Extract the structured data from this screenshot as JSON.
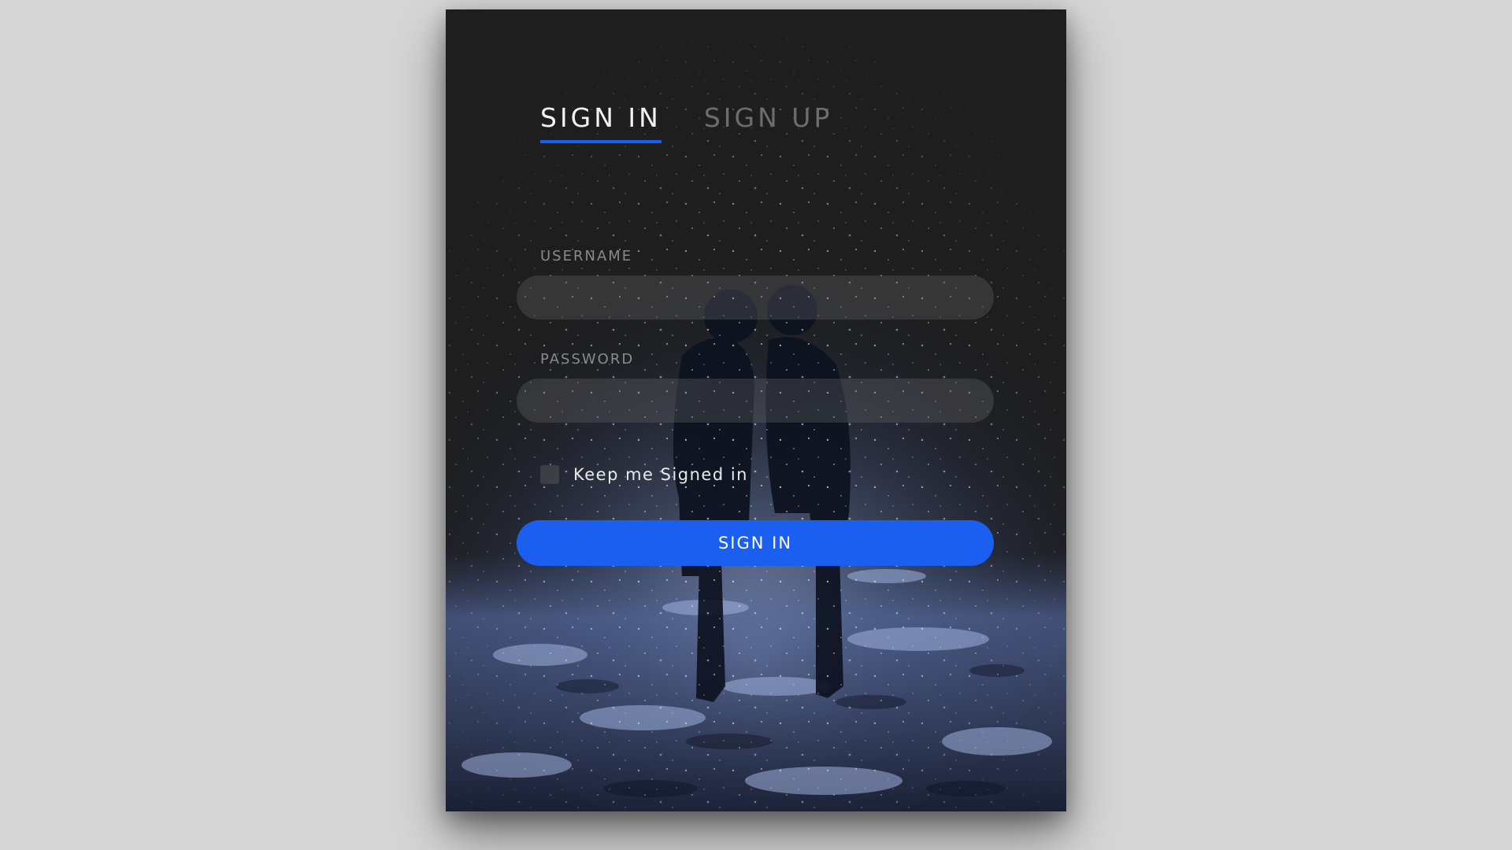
{
  "tabs": {
    "sign_in": "SIGN IN",
    "sign_up": "SIGN UP"
  },
  "form": {
    "username_label": "USERNAME",
    "username_value": "",
    "password_label": "PASSWORD",
    "password_value": "",
    "keep_signed_in_label": "Keep me Signed in",
    "keep_signed_in_checked": false,
    "submit_label": "SIGN IN"
  },
  "colors": {
    "accent": "#1a5ff0",
    "card_background": "#1e1e1f",
    "page_background": "#d6d6d6"
  },
  "background_image": "silhouette-couple-kissing-in-snow-photo"
}
